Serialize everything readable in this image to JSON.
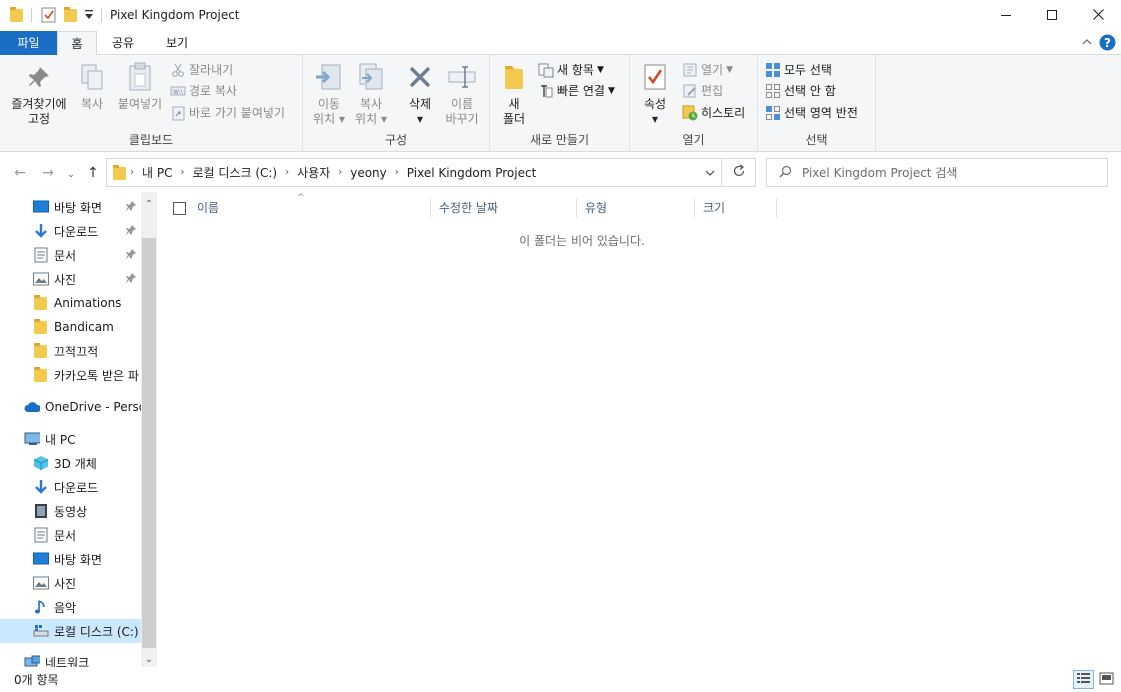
{
  "window": {
    "title": "Pixel Kingdom Project",
    "minimize_icon": "minimize-icon",
    "maximize_icon": "maximize-icon",
    "close_icon": "close-icon"
  },
  "tabs": {
    "file": "파일",
    "home": "홈",
    "share": "공유",
    "view": "보기"
  },
  "ribbon": {
    "clipboard": {
      "label": "클립보드",
      "pin": "즐겨찾기에\n고정",
      "pin_line1": "즐겨찾기에",
      "pin_line2": "고정",
      "copy": "복사",
      "paste": "붙여넣기",
      "cut": "잘라내기",
      "copy_path": "경로 복사",
      "paste_shortcut": "바로 가기 붙여넣기"
    },
    "organize": {
      "label": "구성",
      "move_line1": "이동",
      "move_line2": "위치",
      "copy_line1": "복사",
      "copy_line2": "위치",
      "delete": "삭제",
      "rename_line1": "이름",
      "rename_line2": "바꾸기"
    },
    "new": {
      "label": "새로 만들기",
      "folder_line1": "새",
      "folder_line2": "폴더",
      "new_item": "새 항목",
      "easy_access": "빠른 연결"
    },
    "open": {
      "label": "열기",
      "properties": "속성",
      "open": "열기",
      "edit": "편집",
      "history": "히스토리"
    },
    "select": {
      "label": "선택",
      "select_all": "모두 선택",
      "select_none": "선택 안 함",
      "invert": "선택 영역 반전"
    }
  },
  "address": {
    "crumbs": [
      "내 PC",
      "로컬 디스크 (C:)",
      "사용자",
      "yeony",
      "Pixel Kingdom Project"
    ],
    "search_placeholder": "Pixel Kingdom Project 검색"
  },
  "nav_pane": {
    "quick_access": [
      {
        "label": "바탕 화면",
        "icon": "desktop-icon",
        "pinned": true
      },
      {
        "label": "다운로드",
        "icon": "download-icon",
        "pinned": true
      },
      {
        "label": "문서",
        "icon": "document-icon",
        "pinned": true
      },
      {
        "label": "사진",
        "icon": "pictures-icon",
        "pinned": true
      },
      {
        "label": "Animations",
        "icon": "folder-icon",
        "pinned": false
      },
      {
        "label": "Bandicam",
        "icon": "folder-icon",
        "pinned": false
      },
      {
        "label": "끄적끄적",
        "icon": "folder-icon",
        "pinned": false
      },
      {
        "label": "카카오톡 받은 파",
        "icon": "folder-icon",
        "pinned": false
      }
    ],
    "onedrive": "OneDrive - Persor",
    "this_pc": "내 PC",
    "pc_items": [
      {
        "label": "3D 개체",
        "icon": "3d-objects-icon"
      },
      {
        "label": "다운로드",
        "icon": "download-icon"
      },
      {
        "label": "동영상",
        "icon": "video-icon"
      },
      {
        "label": "문서",
        "icon": "document-icon"
      },
      {
        "label": "바탕 화면",
        "icon": "desktop-icon"
      },
      {
        "label": "사진",
        "icon": "pictures-icon"
      },
      {
        "label": "음악",
        "icon": "music-icon"
      },
      {
        "label": "로컬 디스크 (C:)",
        "icon": "drive-icon"
      }
    ],
    "network": "네트워크"
  },
  "columns": {
    "name": "이름",
    "modified": "수정한 날짜",
    "type": "유형",
    "size": "크기"
  },
  "content": {
    "empty_message": "이 폴더는 비어 있습니다."
  },
  "status": {
    "count": "0개 항목"
  },
  "colors": {
    "accent": "#1a6fc4",
    "selection": "#cce8ff",
    "folder": "#f4c94f"
  }
}
